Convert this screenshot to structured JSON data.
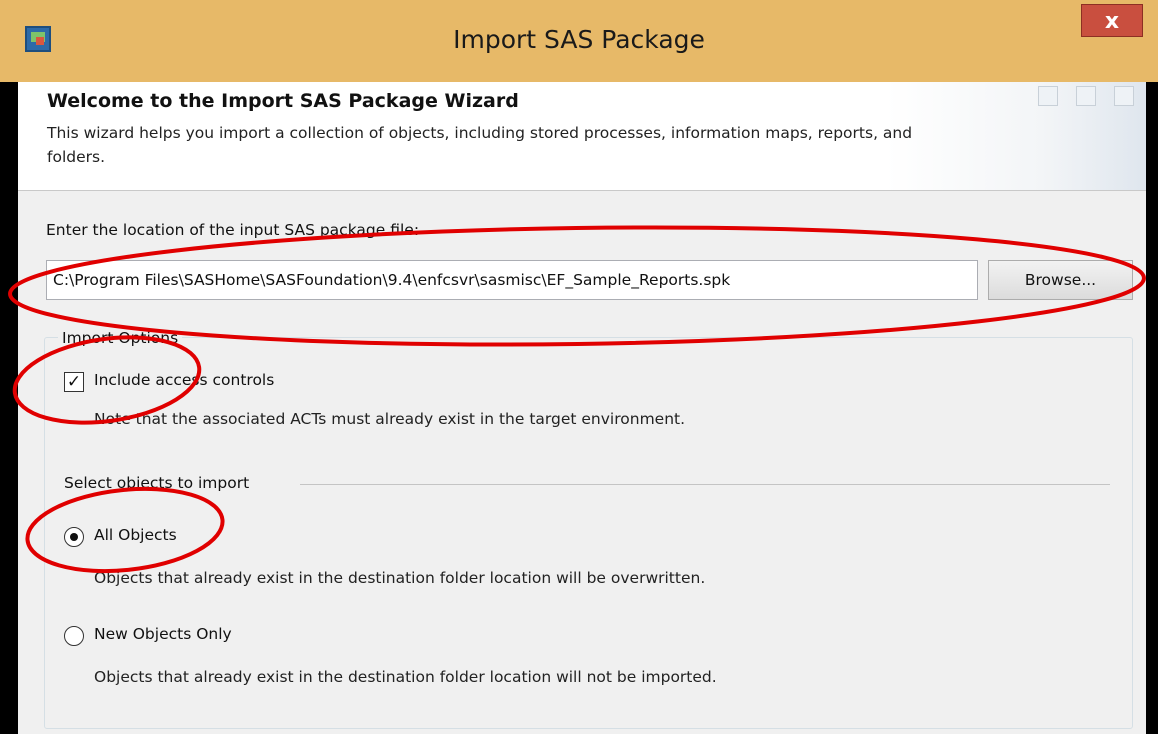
{
  "window": {
    "title": "Import SAS Package",
    "close_label": "x"
  },
  "header": {
    "title": "Welcome to the Import SAS Package Wizard",
    "description": "This wizard helps you import a collection of objects, including stored processes, information maps, reports, and folders."
  },
  "location": {
    "label": "Enter the location of the input SAS package file:",
    "path_value": "C:\\Program Files\\SASHome\\SASFoundation\\9.4\\enfcsvr\\sasmisc\\EF_Sample_Reports.spk",
    "browse_label": "Browse..."
  },
  "import_options": {
    "group_label": "Import Options",
    "include_access_controls_label": "Include access controls",
    "include_access_controls_checked": true,
    "note": "Note that the associated ACTs must already exist in the target environment."
  },
  "select_objects": {
    "label": "Select objects to import",
    "options": [
      {
        "label": "All Objects",
        "selected": true,
        "description": "Objects that already exist in the destination folder location will be overwritten."
      },
      {
        "label": "New Objects Only",
        "selected": false,
        "description": "Objects that already exist in the destination folder location will not be imported."
      }
    ]
  },
  "colors": {
    "titlebar": "#e7b968",
    "close_button": "#c94f3f",
    "annotation": "#e00000",
    "body_background": "#f0f0f0"
  }
}
